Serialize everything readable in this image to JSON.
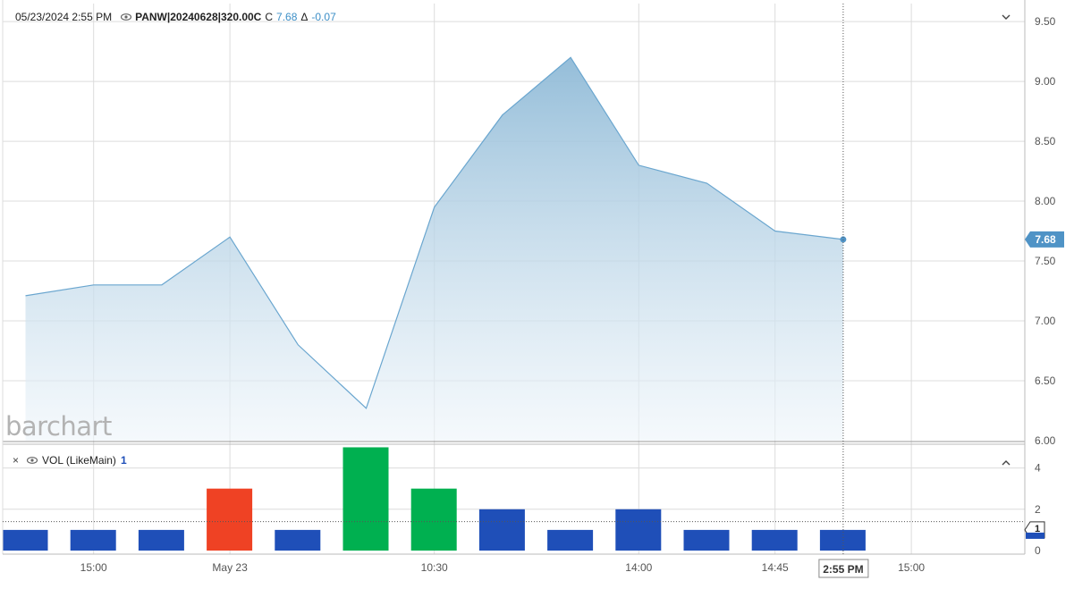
{
  "header": {
    "datetime": "05/23/2024 2:55 PM",
    "symbol": "PANW|20240628|320.00C",
    "close_label": "C",
    "close_value": "7.68",
    "delta_symbol": "Δ",
    "delta_value": "-0.07"
  },
  "logo": "barchart",
  "volume_panel": {
    "close_glyph": "×",
    "label": "VOL (LikeMain)",
    "count": "1",
    "collapse_glyph": "^"
  },
  "price_panel": {
    "collapse_glyph": "v"
  },
  "last_price_badge": "7.68",
  "volume_badge": "1",
  "crosshair_label": "2:55 PM",
  "colors": {
    "line": "#6aa6cf",
    "area_top": "#8fbad7",
    "area_bottom": "#eef5fa",
    "up": "#00b050",
    "down": "#ef4224",
    "neutral": "#1f4fb8",
    "badge": "#4f93c6",
    "grid": "#dcdcdc"
  },
  "chart_data": [
    {
      "type": "area",
      "x": [
        "slot1",
        "slot2",
        "slot3",
        "slot4",
        "slot5",
        "slot6",
        "slot7",
        "slot8",
        "slot9",
        "slot10",
        "slot11",
        "slot12",
        "slot13"
      ],
      "values": [
        7.21,
        7.3,
        7.3,
        7.7,
        6.8,
        6.27,
        7.95,
        8.72,
        9.2,
        8.3,
        8.15,
        7.75,
        7.68
      ],
      "ylim": [
        6.0,
        9.65
      ],
      "yticks": [
        "6.00",
        "6.50",
        "7.00",
        "7.50",
        "8.00",
        "8.50",
        "9.00",
        "9.50"
      ],
      "ytick_values": [
        6.0,
        6.5,
        7.0,
        7.5,
        8.0,
        8.5,
        9.0,
        9.5
      ],
      "grid": true
    },
    {
      "type": "bar",
      "values": [
        1,
        1,
        1,
        3,
        1,
        5,
        3,
        2,
        1,
        2,
        1,
        1,
        1
      ],
      "bar_colors": [
        "neutral",
        "neutral",
        "neutral",
        "down",
        "neutral",
        "up",
        "up",
        "neutral",
        "neutral",
        "neutral",
        "neutral",
        "neutral",
        "neutral"
      ],
      "ylim": [
        0,
        5.15
      ],
      "yticks": [
        "0",
        "2",
        "4"
      ],
      "ytick_values": [
        0,
        2,
        4
      ],
      "reference_line": 1.4
    }
  ],
  "x_axis": {
    "ticks": [
      {
        "label": "15:00",
        "slot": 2
      },
      {
        "label": "May 23",
        "slot": 4
      },
      {
        "label": "10:30",
        "slot": 7
      },
      {
        "label": "14:00",
        "slot": 10
      },
      {
        "label": "14:45",
        "slot": 12
      },
      {
        "label": "15:00",
        "slot": 14
      }
    ],
    "crosshair_slot": 13
  }
}
